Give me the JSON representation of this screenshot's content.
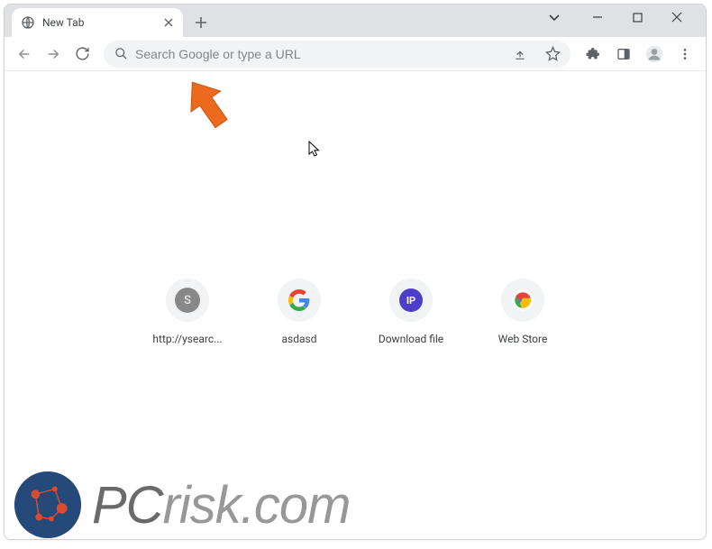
{
  "window": {
    "tab_title": "New Tab"
  },
  "omnibox": {
    "placeholder": "Search Google or type a URL",
    "value": ""
  },
  "shortcuts": [
    {
      "label": "http://ysearc...",
      "kind": "letter",
      "letter": "S"
    },
    {
      "label": "asdasd",
      "kind": "google"
    },
    {
      "label": "Download file",
      "kind": "ip"
    },
    {
      "label": "Web Store",
      "kind": "webstore"
    }
  ],
  "icons": {
    "arrow_color": "#e86b1f",
    "ip_text": "IP"
  },
  "watermark": {
    "text_a": "PC",
    "text_b": "risk",
    "text_c": ".com"
  }
}
